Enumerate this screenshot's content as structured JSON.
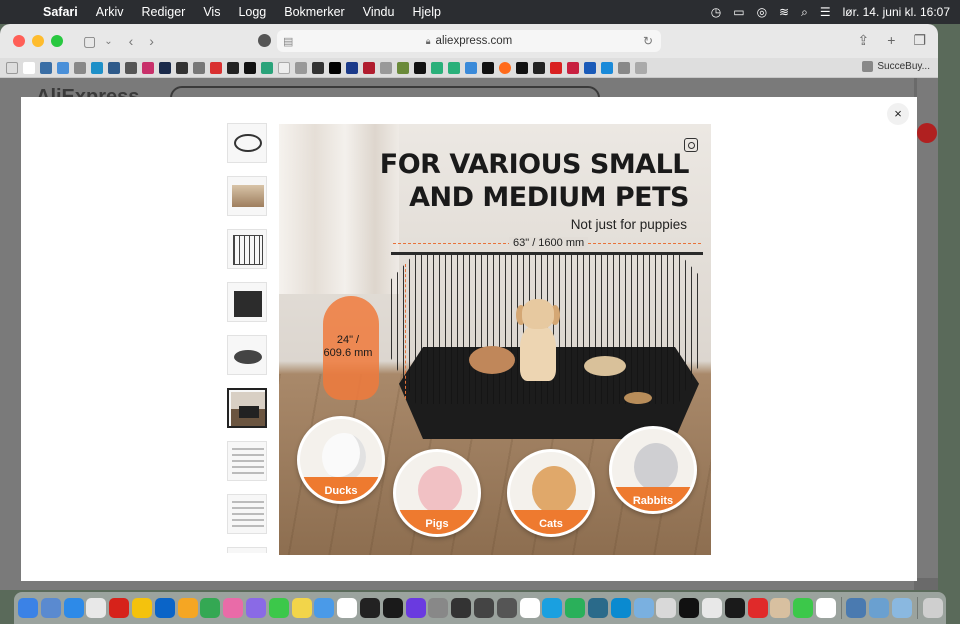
{
  "menubar": {
    "app": "Safari",
    "items": [
      "Arkiv",
      "Rediger",
      "Vis",
      "Logg",
      "Bokmerker",
      "Vindu",
      "Hjelp"
    ],
    "datetime": "lør. 14. juni kl. 16:07"
  },
  "browser": {
    "url": "aliexpress.com",
    "favorites_last": "SucceBuy..."
  },
  "page": {
    "logo": "AliExpress"
  },
  "modal": {
    "close_label": "×",
    "thumbnail_count": 9,
    "selected_thumbnail_index": 6,
    "image": {
      "headline_line1": "FOR VARIOUS SMALL",
      "headline_line2": "AND MEDIUM PETS",
      "subline": "Not just for puppies",
      "width_dim": "63\" / 1600 mm",
      "height_dim_1": "24\" /",
      "height_dim_2": "609.6 mm",
      "pets": [
        "Ducks",
        "Pigs",
        "Cats",
        "Rabbits"
      ]
    }
  },
  "colors": {
    "accent": "#ee7a2f",
    "menubar": "#2b2d31",
    "modal_bg": "#ffffff"
  }
}
